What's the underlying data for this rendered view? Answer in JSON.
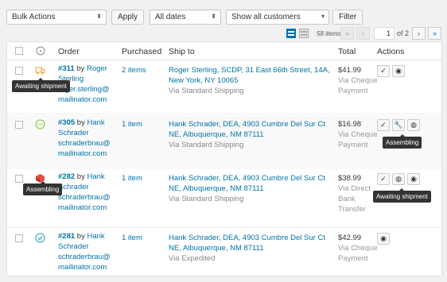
{
  "toolbar": {
    "bulk_actions": "Bulk Actions",
    "apply": "Apply",
    "dates": "All dates",
    "customers": "Show all customers",
    "filter": "Filter"
  },
  "pager": {
    "items": "58 items",
    "first": "«",
    "prev": "‹",
    "current_page": "1",
    "of": "of 2",
    "next": "›",
    "last": "»"
  },
  "columns": {
    "order": "Order",
    "purchased": "Purchased",
    "ship_to": "Ship to",
    "total": "Total",
    "actions": "Actions"
  },
  "orders": [
    {
      "number": "#311",
      "by": "by",
      "customer": "Roger Sterling",
      "email": "roger.sterling@ mailinator.com",
      "purchased": "2 items",
      "address": "Roger Sterling, SCDP, 31 East 66th Street, 14A, New York, NY 10065",
      "method": "Via Standard Shipping",
      "total": "$41.99",
      "payment": "Via Cheque Payment",
      "status": "awaiting-shipment"
    },
    {
      "number": "#305",
      "by": "by",
      "customer": "Hank Schrader",
      "email": "schraderbrau@ mailinator.com",
      "purchased": "1 item",
      "address": "Hank Schrader, DEA, 4903 Cumbre Del Sur Ct NE, Albuquerque, NM 87111",
      "method": "Via Standard Shipping",
      "total": "$16.98",
      "payment": "Via Cheque Payment",
      "status": "pending"
    },
    {
      "number": "#282",
      "by": "by",
      "customer": "Hank Schrader",
      "email": "schraderbrau@ mailinator.com",
      "purchased": "1 item",
      "address": "Hank Schrader, DEA, 4903 Cumbre Del Sur Ct NE, Albuquerque, NM 87111",
      "method": "Via Standard Shipping",
      "total": "$38.99",
      "payment": "Via Direct Bank Transfer",
      "status": "assembling"
    },
    {
      "number": "#281",
      "by": "by",
      "customer": "Hank Schrader",
      "email": "schraderbrau@ mailinator.com",
      "purchased": "1 item",
      "address": "Hank Schrader, DEA, 4903 Cumbre Del Sur Ct NE, Albuquerque, NM 87111",
      "method": "Via Expedited",
      "total": "$42.99",
      "payment": "Via Cheque Payment",
      "status": "completed"
    }
  ],
  "tooltips": {
    "row1_status": "Awaiting shipment",
    "row2_action": "Assembling",
    "row3_status": "Assembling",
    "row3_action": "Awaiting shipment"
  },
  "colors": {
    "link": "#0073aa",
    "awaiting": "#f0ad4e",
    "pending": "#7ad03a",
    "assembling": "#e74c3c",
    "completed": "#2ea2cc"
  }
}
